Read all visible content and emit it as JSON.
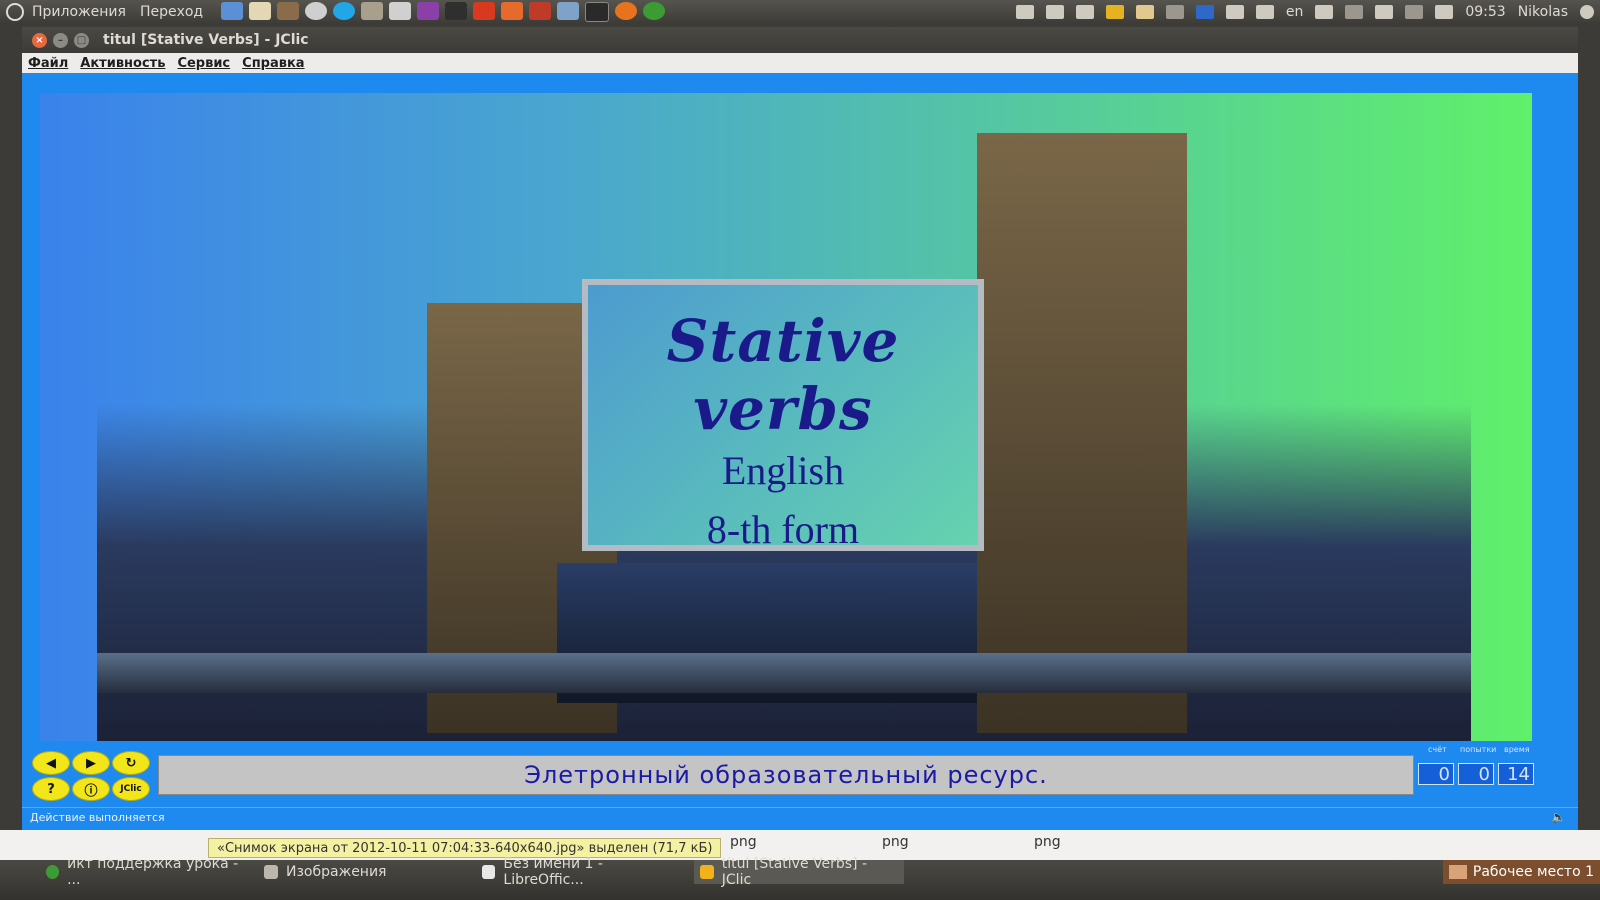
{
  "top_panel": {
    "apps_menu": "Приложения",
    "places_menu": "Переход",
    "launcher_icons": [
      "document-icon",
      "book-icon",
      "toolbox-icon",
      "disc-icon",
      "skype-icon",
      "library-icon",
      "camera-icon",
      "terminal-purple-icon",
      "monitor-icon",
      "red-app-icon",
      "folder-icon",
      "printer-icon",
      "cube-icon",
      "terminal-icon",
      "firefox-icon",
      "chrome-icon"
    ],
    "tray": {
      "keyboard_layout": "en",
      "clock": "09:53",
      "user": "Nikolas"
    }
  },
  "window": {
    "title": "titul [Stative Verbs] - JClic",
    "menu": [
      "Файл",
      "Активность",
      "Сервис",
      "Справка"
    ]
  },
  "activity": {
    "title_ornament": "Stative verbs",
    "subtitle": "English",
    "form": "8-th form",
    "message": "Элетронный образовательный ресурс.",
    "counters": {
      "score_label": "счёт",
      "attempts_label": "попытки",
      "time_label": "время",
      "score": "0",
      "attempts": "0",
      "time": "14"
    },
    "status": "Действие выполняется",
    "jclic_label": "JClic"
  },
  "background_strip": {
    "file_type_1": "png",
    "file_type_2": "png",
    "file_type_3": "png",
    "tooltip": "«Снимок экрана от 2012-10-11 07:04:33-640x640.jpg» выделен (71,7 кБ)"
  },
  "taskbar": {
    "tasks": [
      "икт поддержка урока - ...",
      "Изображения",
      "Без имени 1 - LibreOffic...",
      "titul [Stative Verbs] - JClic"
    ],
    "workspace": "Рабочее место 1"
  }
}
